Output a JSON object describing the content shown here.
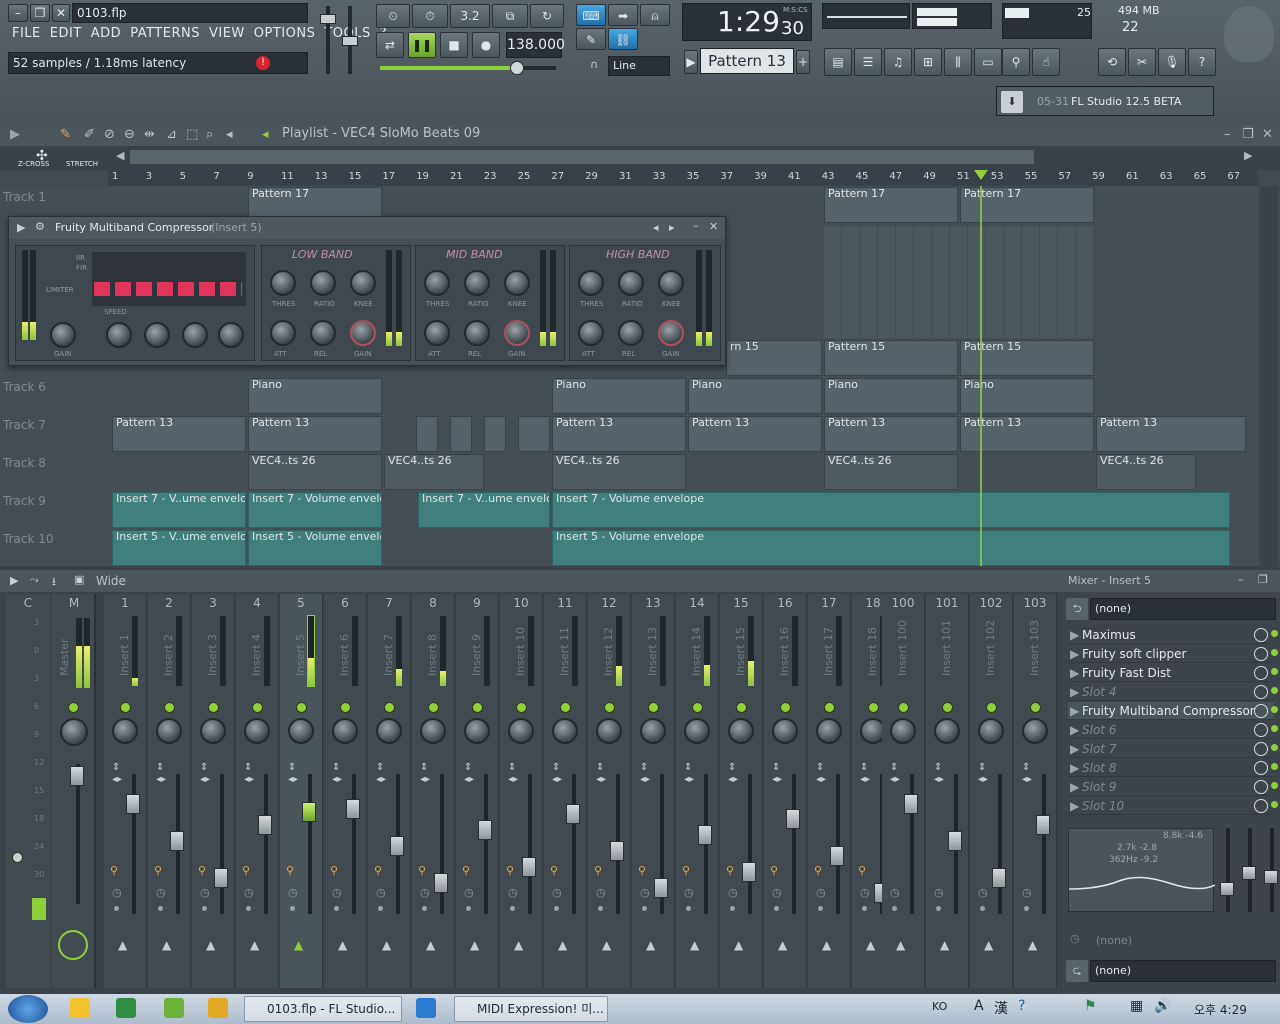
{
  "window": {
    "title": "0103.flp"
  },
  "menu": [
    "FILE",
    "EDIT",
    "ADD",
    "PATTERNS",
    "VIEW",
    "OPTIONS",
    "TOOLS",
    "?"
  ],
  "status": {
    "latency": "52 samples / 1.18ms latency"
  },
  "transport": {
    "tempo": "138.000",
    "time": "1:29",
    "time_sub": "30",
    "time_mode": "M:S:CS",
    "snap": "Line",
    "pattern": "Pattern 13",
    "step_mode": "3.2"
  },
  "cpu": {
    "value": "25",
    "memory": "494 MB",
    "poly": "22"
  },
  "news": {
    "date": "05-31",
    "text": "FL Studio 12.5 BETA"
  },
  "playlist": {
    "title": "Playlist - VEC4 SloMo Beats 09",
    "zcross": "Z-CROSS",
    "stretch": "STRETCH",
    "ruler": [
      "1",
      "3",
      "5",
      "7",
      "9",
      "11",
      "13",
      "15",
      "17",
      "19",
      "21",
      "23",
      "25",
      "27",
      "29",
      "31",
      "33",
      "35",
      "37",
      "39",
      "41",
      "43",
      "45",
      "47",
      "49",
      "51",
      "53",
      "55",
      "57",
      "59",
      "61",
      "63",
      "65",
      "67"
    ],
    "tracks": [
      "Track 1",
      "Track 6",
      "Track 7",
      "Track 8",
      "Track 9",
      "Track 10"
    ],
    "clips": {
      "p17": "Pattern 17",
      "p15": "Pattern 15",
      "p15b": "rn 15",
      "piano": "Piano",
      "p13": "Pattern 13",
      "vec": "VEC4..ts 26",
      "env7a": "Insert 7 - V..ume envelope",
      "env7b": "Insert 7 - Volume envelope",
      "env5a": "Insert 5 - V..ume envelope",
      "env5b": "Insert 5 - Volume envelope"
    }
  },
  "compressor": {
    "title": "Fruity Multiband Compressor",
    "insert": "(Insert 5)",
    "low": "LOW BAND",
    "mid": "MID BAND",
    "high": "HIGH BAND",
    "limiter": "LIMITER",
    "speed": "SPEED",
    "iir": "IIR",
    "fir": "FIR",
    "knobs": {
      "thres": "THRES",
      "ratio": "RATIO",
      "knee": "KNEE",
      "att": "ATT",
      "rel": "REL",
      "gain": "GAIN"
    }
  },
  "mixer": {
    "mode": "Wide",
    "title": "Mixer - Insert 5",
    "db_scale": [
      "3",
      "0",
      "3",
      "6",
      "9",
      "12",
      "15",
      "18",
      "24",
      "30"
    ],
    "master": {
      "num": "M",
      "name": "Master"
    },
    "current": {
      "num": "C"
    },
    "strips": [
      {
        "num": "1",
        "name": "Insert 1",
        "level": 0.12
      },
      {
        "num": "2",
        "name": "Insert 2",
        "level": 0
      },
      {
        "num": "3",
        "name": "Insert 3",
        "level": 0
      },
      {
        "num": "4",
        "name": "Insert 4",
        "level": 0
      },
      {
        "num": "5",
        "name": "Insert 5",
        "level": 0.4
      },
      {
        "num": "6",
        "name": "Insert 6",
        "level": 0
      },
      {
        "num": "7",
        "name": "Insert 7",
        "level": 0.25
      },
      {
        "num": "8",
        "name": "Insert 8",
        "level": 0.22
      },
      {
        "num": "9",
        "name": "Insert 9",
        "level": 0
      },
      {
        "num": "10",
        "name": "Insert 10",
        "level": 0
      },
      {
        "num": "11",
        "name": "Insert 11",
        "level": 0
      },
      {
        "num": "12",
        "name": "Insert 12",
        "level": 0.28
      },
      {
        "num": "13",
        "name": "Insert 13",
        "level": 0
      },
      {
        "num": "14",
        "name": "Insert 14",
        "level": 0.3
      },
      {
        "num": "15",
        "name": "Insert 15",
        "level": 0.36
      },
      {
        "num": "16",
        "name": "Insert 16",
        "level": 0
      },
      {
        "num": "17",
        "name": "Insert 17",
        "level": 0
      },
      {
        "num": "18",
        "name": "Insert 18",
        "level": 0
      }
    ],
    "right_strips": [
      {
        "num": "100",
        "name": "Insert 100"
      },
      {
        "num": "101",
        "name": "Insert 101"
      },
      {
        "num": "102",
        "name": "Insert 102"
      },
      {
        "num": "103",
        "name": "Insert 103"
      }
    ],
    "input": "(none)",
    "output": "(none)",
    "sidechain": "(none)",
    "slots": [
      "Maximus",
      "Fruity soft clipper",
      "Fruity Fast Dist",
      "Slot 4",
      "Fruity Multiband Compressor",
      "Slot 6",
      "Slot 7",
      "Slot 8",
      "Slot 9",
      "Slot 10"
    ],
    "eq": {
      "v1": "8.8k -4.6",
      "v2": "2.7k -2.8",
      "v3": "362Hz -9.2"
    }
  },
  "taskbar": {
    "items": [
      "0103.flp - FL Studio...",
      "MIDI Expression! 미..."
    ],
    "lang": "KO",
    "ime1": "A",
    "ime2": "漢",
    "clock": "오후 4:29"
  },
  "colors": {
    "accent": "#8ed03c",
    "automation": "#3f7f7c",
    "background": "#3a4248"
  }
}
